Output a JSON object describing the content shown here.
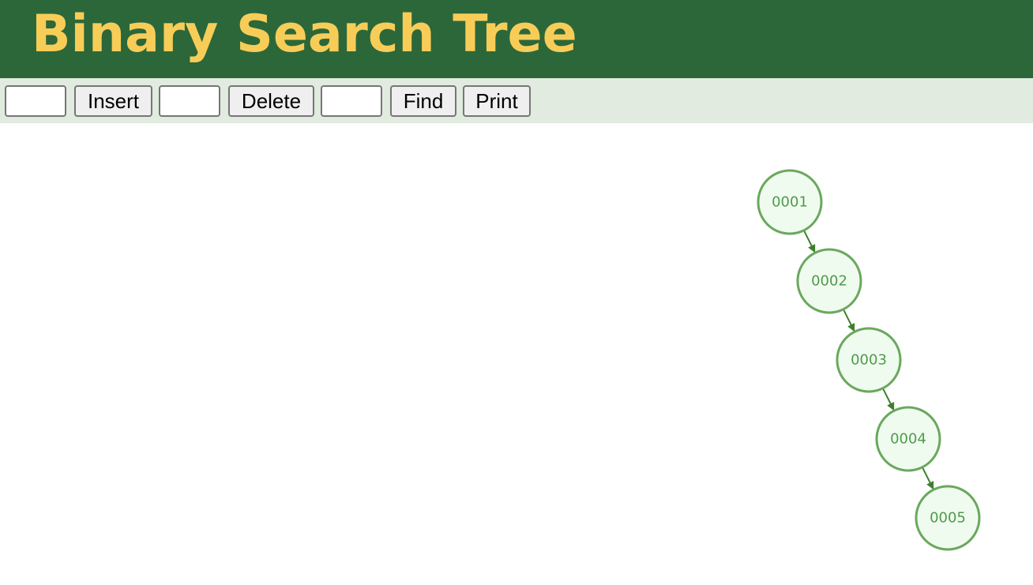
{
  "header": {
    "title": "Binary Search Tree"
  },
  "toolbar": {
    "insert_value": "",
    "insert_label": "Insert",
    "delete_value": "",
    "delete_label": "Delete",
    "find_value": "",
    "find_label": "Find",
    "print_label": "Print"
  },
  "tree": {
    "nodes": [
      "0001",
      "0002",
      "0003",
      "0004",
      "0005"
    ],
    "edges": [
      [
        "0001",
        "0002"
      ],
      [
        "0002",
        "0003"
      ],
      [
        "0003",
        "0004"
      ],
      [
        "0004",
        "0005"
      ]
    ]
  },
  "colors": {
    "header_bg": "#2c673a",
    "title": "#f7cd58",
    "toolbar_bg": "#e1ebe0",
    "node_fill": "#f0fbef",
    "node_stroke": "#6aa85e",
    "node_text": "#4f9a4a",
    "edge": "#3f7f2c"
  }
}
